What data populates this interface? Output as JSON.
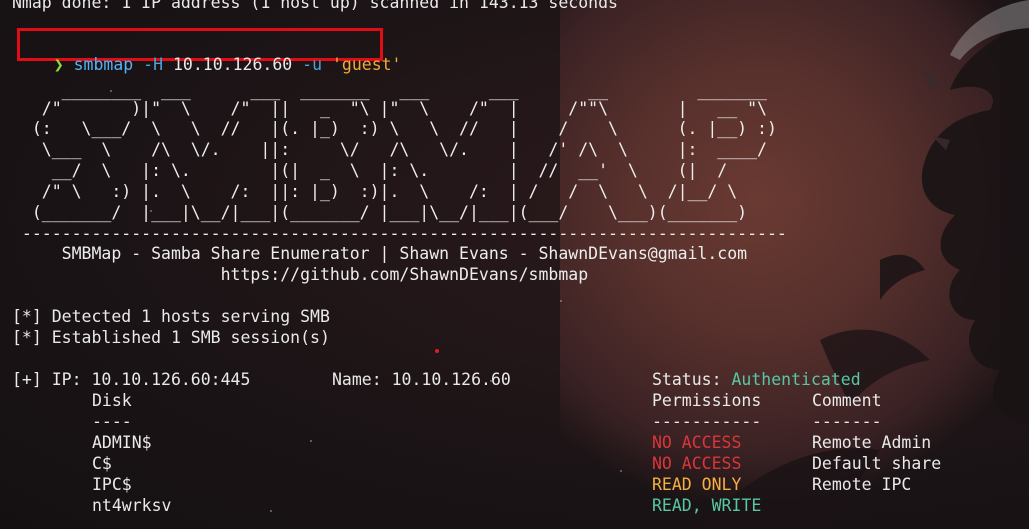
{
  "terminal": {
    "nmap_done": "Nmap done: 1 IP address (1 host up) scanned in 143.13 seconds",
    "prompt_symbol": "❯",
    "command": {
      "program": "smbmap",
      "flag_h": "-H",
      "host": "10.10.126.60",
      "flag_u": "-u",
      "user": "'guest'"
    },
    "banner": [
      "     ________  ___      ___  _______   ___      ___       __         _______",
      "   /\"       )|\"  \\    /\"  ||   _  \"\\ |\"  \\    /\"  |     /\"\"\\       |   __ \"\\",
      "  (:   \\___/  \\   \\  //   |(. |_)  :) \\   \\  //   |    /    \\      (. |__) :)",
      "   \\___  \\    /\\  \\/.    ||:     \\/   /\\   \\/.    |   /' /\\  \\     |:  ____/",
      "    __/  \\   |: \\.        |(|  _  \\  |: \\.        |  //  __'  \\    (|  /",
      "   /\" \\   :) |.  \\    /:  ||: |_)  :)|.  \\    /:  | /   /  \\   \\  /|__/ \\",
      "  (_______/  |___|\\__/|___|(_______/ |___|\\__/|___|(___/    \\___)(_______)"
    ],
    "separator": " -----------------------------------------------------------------------------",
    "credit": "     SMBMap - Samba Share Enumerator | Shawn Evans - ShawnDEvans@gmail.com",
    "url": "                     https://github.com/ShawnDEvans/smbmap",
    "detected": "[*] Detected 1 hosts serving SMB",
    "established": "[*] Established 1 SMB session(s)",
    "ip_line": {
      "prefix": "[+] IP: 10.10.126.60:445",
      "name": "Name: 10.10.126.60",
      "status_label": "Status: ",
      "status_value": "Authenticated"
    },
    "table": {
      "headers": {
        "disk": "Disk",
        "permissions": "Permissions",
        "comment": "Comment"
      },
      "underline": {
        "disk": "----",
        "permissions": "-----------",
        "comment": "-------"
      },
      "rows": [
        {
          "disk": "ADMIN$",
          "permissions": "NO ACCESS",
          "perm_color": "#d9363a",
          "comment": "Remote Admin"
        },
        {
          "disk": "C$",
          "permissions": "NO ACCESS",
          "perm_color": "#d9363a",
          "comment": "Default share"
        },
        {
          "disk": "IPC$",
          "permissions": "READ ONLY",
          "perm_color": "#f5b041",
          "comment": "Remote IPC"
        },
        {
          "disk": "nt4wrksv",
          "permissions": "READ, WRITE",
          "perm_color": "#58c7a3",
          "comment": ""
        }
      ]
    }
  },
  "colors": {
    "highlight_box": "#e00d16",
    "prompt": "#8ddc3c",
    "command": "#54b3f4",
    "string": "#f2a93b"
  },
  "icons": {
    "background": "dragon-moon-wallpaper"
  }
}
